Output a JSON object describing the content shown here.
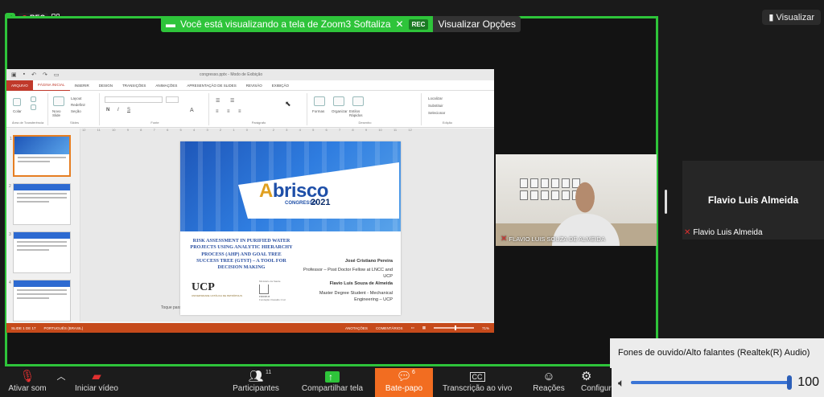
{
  "top": {
    "rec": "REC",
    "share_banner": "Você está visualizando a tela de Zoom3 Softaliza",
    "banner_rec": "REC",
    "view_options": "Visualizar Opções",
    "view_button": "Visualizar"
  },
  "ppt": {
    "doc_title": "congresso.pptx - Modo de Exibição",
    "tabs": [
      "ARQUIVO",
      "PÁGINA INICIAL",
      "INSERIR",
      "DESIGN",
      "TRANSIÇÕES",
      "ANIMAÇÕES",
      "APRESENTAÇÃO DE SLIDES",
      "REVISÃO",
      "EXIBIÇÃO"
    ],
    "ribbon_groups": [
      "Área de Transferência",
      "Slides",
      "Fonte",
      "Parágrafo",
      "Desenho",
      "Edição"
    ],
    "ribbon_items": {
      "layout": "Layout",
      "reset": "Redefinir",
      "section": "Seção",
      "new_slide": "Novo Slide",
      "paste": "Colar",
      "shapes": "Formas",
      "arrange": "Organizar",
      "quick_styles": "Estilos Rápidos",
      "find": "Localizar",
      "replace": "Substituir",
      "select": "Selecionar"
    },
    "ruler": [
      "12",
      "11",
      "10",
      "9",
      "8",
      "7",
      "6",
      "5",
      "4",
      "3",
      "2",
      "1",
      "0",
      "1",
      "2",
      "3",
      "4",
      "5",
      "6",
      "7",
      "8",
      "9",
      "10",
      "11",
      "12"
    ],
    "thumb_numbers": [
      "1",
      "2",
      "3",
      "4"
    ],
    "notes": "Toque para adicionar notas",
    "status_left": "SLIDE 1 DE 17",
    "status_lang": "PORTUGUÊS (BRASIL)",
    "status_notes": "ANOTAÇÕES",
    "status_comments": "COMENTÁRIOS",
    "zoom": "71%"
  },
  "slide": {
    "logo_brand": "brisco",
    "logo_letter": "A",
    "logo_sub": "CONGRESSO",
    "logo_year": "2021",
    "title": "RISK ASSESSMENT IN PURIFIED WATER PROJECTS USING ANALYTIC HIERARCHY PROCESS (AHP) AND GOAL TREE SUCCESS TREE (GTST) – A TOOL FOR DECISION MAKING",
    "author1_name": "José Cristiano Pereira",
    "author1_role": "Professor – Post Doctor Fellow at LNCC and UCP",
    "author2_name": "Flavio Luis Souza de Almeida",
    "author2_role": "Master Degree Student - Mechanical Engineering – UCP",
    "ucp_logo": "UCP",
    "ucp_sub": "UNIVERSIDADE CATÓLICA DE PETRÓPOLIS",
    "fiocruz_top": "Ministério da Saúde",
    "fiocruz_name": "FIOCRUZ",
    "fiocruz_sub": "Fundação Oswaldo Cruz"
  },
  "participants": {
    "video_name": "FLAVIO LUIS SOUZA DE ALMEIDA",
    "tile_name": "Flavio Luis Almeida",
    "tile_label": "Flavio Luis Almeida"
  },
  "audio": {
    "device": "Fones de ouvido/Alto falantes (Realtek(R) Audio)",
    "volume": "100",
    "volume_fraction": 1.0
  },
  "toolbar": {
    "audio": "Ativar som",
    "video": "Iniciar vídeo",
    "participants": "Participantes",
    "participants_count": "11",
    "share": "Compartilhar tela",
    "chat": "Bate-papo",
    "chat_count": "6",
    "transcription": "Transcrição ao vivo",
    "reactions": "Reações",
    "settings": "Configurações",
    "cc_icon_text": "CC"
  },
  "colors": {
    "share_green": "#2ec43a",
    "chat_orange": "#f26d21",
    "ppt_accent": "#c64a1b",
    "volume_blue": "#3b75d6"
  }
}
